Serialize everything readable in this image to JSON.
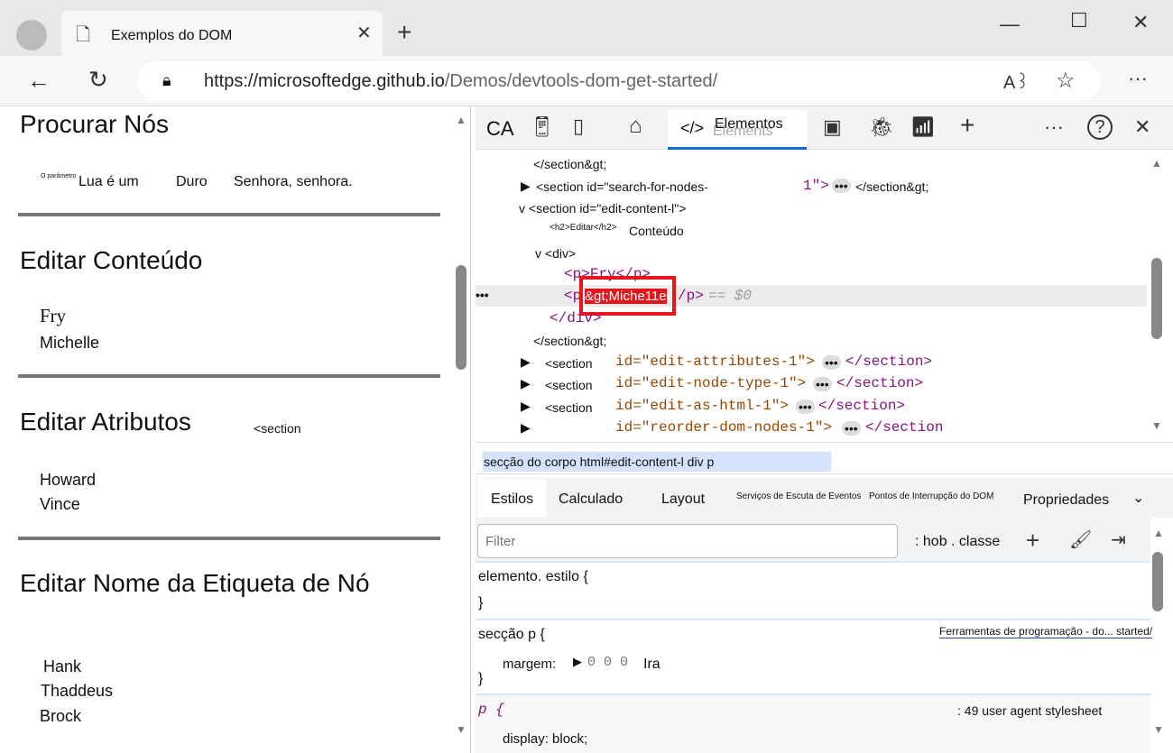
{
  "browser": {
    "tab_title": "Exemplos do DOM",
    "url_host": "https://microsoftedge.github.io",
    "url_path": "/Demos/devtools-dom-get-started/",
    "icons": [
      "avatar",
      "page-icon",
      "close-icon",
      "new-tab-icon",
      "minimize-icon",
      "maximize-icon",
      "close-window-icon",
      "back-icon",
      "refresh-icon",
      "lock-icon",
      "read-aloud-icon",
      "favorite-icon",
      "more-icon"
    ]
  },
  "page": {
    "s1": {
      "title": "Procurar Nós",
      "small": "O parâmetro",
      "items": [
        "Lua é um",
        "Duro",
        "Senhora, senhora."
      ]
    },
    "s2": {
      "title": "Editar Conteúdo",
      "items": [
        "Fry",
        "Michelle"
      ]
    },
    "s3": {
      "title": "Editar Atributos",
      "aside": "<section",
      "items": [
        "Howard",
        "Vince"
      ]
    },
    "s4": {
      "title": "Editar Nome da Etiqueta de Nó",
      "items": [
        "Hank",
        "Thaddeus",
        "Brock"
      ]
    }
  },
  "devtools": {
    "toolbar": {
      "ca": "CA",
      "active_tab": "Elementos",
      "ghost": "Elements"
    },
    "dom": {
      "l1": "</section&gt;",
      "l2a": "<section id=\"search-for-nodes-",
      "l2b": "1\">",
      "l2c": "</section&gt;",
      "l3": "v <section id=\"edit-content-l\">",
      "l4a": "<h2>Editar</h2>",
      "l4b": "Conteúdo",
      "l5": "v <div>",
      "l6": "<p>Fry</p>",
      "l7a": "<p",
      "l7b": "&gt;Miche11e",
      "l7c": "/p>",
      "l7d": "== $0",
      "l8": "</div>",
      "l9": "</section&gt;",
      "rows": [
        {
          "open": "<section",
          "id": "id=\"edit-attributes-1\">",
          "close": "</section>"
        },
        {
          "open": "<section",
          "id": "id=\"edit-node-type-1\">",
          "close": "</section>"
        },
        {
          "open": "<section",
          "id": "id=\"edit-as-html-1\">",
          "close": "</section>"
        },
        {
          "open": "",
          "id": "id=\"reorder-dom-nodes-1\">",
          "close": "</section"
        }
      ]
    },
    "breadcrumb": "secção do corpo html#edit-content-l div p",
    "tabs": [
      "Estilos",
      "Calculado",
      "Layout",
      "Serviços de Escuta de Eventos",
      "Pontos de Interrupção do DOM",
      "Propriedades"
    ],
    "filter_placeholder": "Filter",
    "hov_cls": ": hob . classe",
    "styles": {
      "r1": "elemento. estilo {",
      "close": "}",
      "r2": "secção p {",
      "r2src": "Ferramentas de programação - do... started/",
      "r2prop": "margem:",
      "r2val": "0 0 0",
      "r2extra": "Ira",
      "r3": "p {",
      "r3src": ": 49 user agent stylesheet",
      "r3prop": "display: block;"
    }
  }
}
